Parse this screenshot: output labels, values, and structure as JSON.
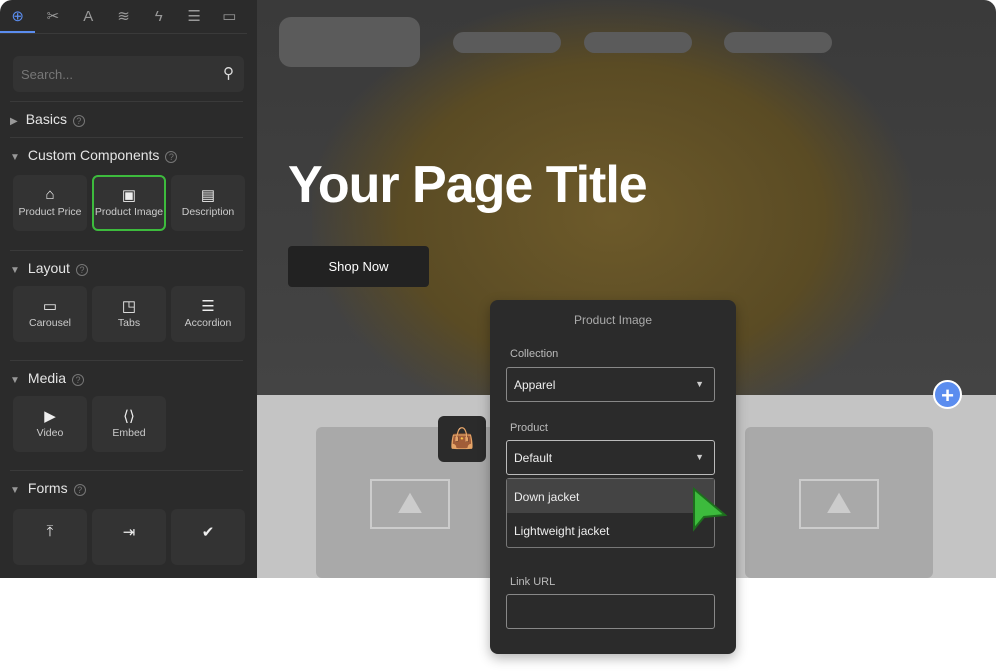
{
  "sidebar": {
    "tabs": [
      "add-icon",
      "tools-icon",
      "typography-icon",
      "layers-icon",
      "lightning-icon",
      "database-icon",
      "comments-icon"
    ],
    "search_placeholder": "Search...",
    "sections": {
      "basics": "Basics",
      "custom": "Custom Components",
      "layout": "Layout",
      "media": "Media",
      "forms": "Forms"
    },
    "custom_items": [
      "Product Price",
      "Product Image",
      "Description"
    ],
    "layout_items": [
      "Carousel",
      "Tabs",
      "Accordion"
    ],
    "media_items": [
      "Video",
      "Embed"
    ]
  },
  "canvas": {
    "title": "Your Page Title",
    "button": "Shop Now"
  },
  "popup": {
    "title": "Product Image",
    "collection_label": "Collection",
    "collection_value": "Apparel",
    "product_label": "Product",
    "product_value": "Default",
    "options": [
      "Down jacket",
      "Lightweight jacket"
    ],
    "link_label": "Link URL",
    "link_value": ""
  },
  "colors": {
    "accent": "#5b8def",
    "selected": "#3dbb3d"
  }
}
